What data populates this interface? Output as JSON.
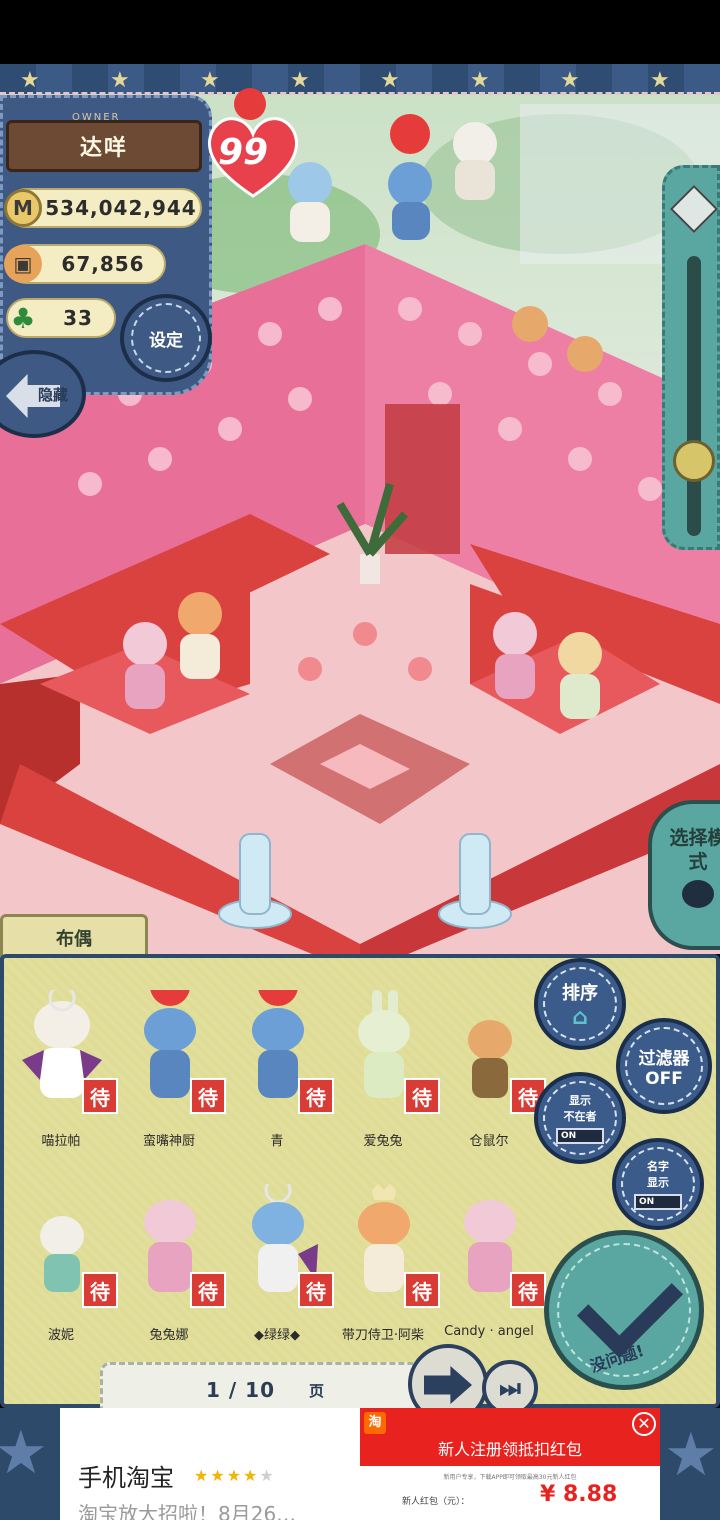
{
  "owner": {
    "label": "OWNER",
    "name": "达咩",
    "hearts": "99",
    "coins": "534,042,944",
    "produce": "67,856",
    "clovers": "33"
  },
  "buttons": {
    "settings": "设定",
    "hide": "隐藏",
    "select_mode": "选择模式",
    "sort": "排序",
    "filter_line1": "过滤器",
    "filter_line2": "OFF",
    "show_absent_line1": "显示",
    "show_absent_line2": "不在者",
    "show_absent_toggle": "ON",
    "name_display_line1": "名字",
    "name_display_line2": "显示",
    "name_display_toggle": "ON",
    "confirm": "没问题!"
  },
  "doll_panel": {
    "tab": "布偶",
    "wait_badge": "待",
    "dolls": [
      {
        "name": "喵拉帕"
      },
      {
        "name": "蛮嘴神厨"
      },
      {
        "name": "青"
      },
      {
        "name": "爱兔兔"
      },
      {
        "name": "仓鼠尔"
      },
      {
        "name": "波妮"
      },
      {
        "name": "兔兔娜"
      },
      {
        "name": "◆绿绿◆"
      },
      {
        "name": "带刀侍卫·阿柴"
      },
      {
        "name": "Candy · angel"
      }
    ],
    "page": "1 / 10",
    "page_unit": "页"
  },
  "ad": {
    "app_name": "手机淘宝",
    "rating": 4,
    "rating_max": 5,
    "description": "淘宝放大招啦！8月26…",
    "image_logo": "淘",
    "image_headline": "新人注册领抵扣红包",
    "image_subtext": "新用户专享，下载APP即可领取最高30元新人红包",
    "image_label": "新人红包（元）：",
    "image_price": "¥ 8.88",
    "close": "✕"
  },
  "colors": {
    "denim": "#3e5a84",
    "teal_button": "#5aa6a0",
    "panel_bg": "#dfdc96",
    "wait_red": "#d93b35",
    "floor_red": "#d9423f",
    "wall_pink": "#e86f98"
  }
}
